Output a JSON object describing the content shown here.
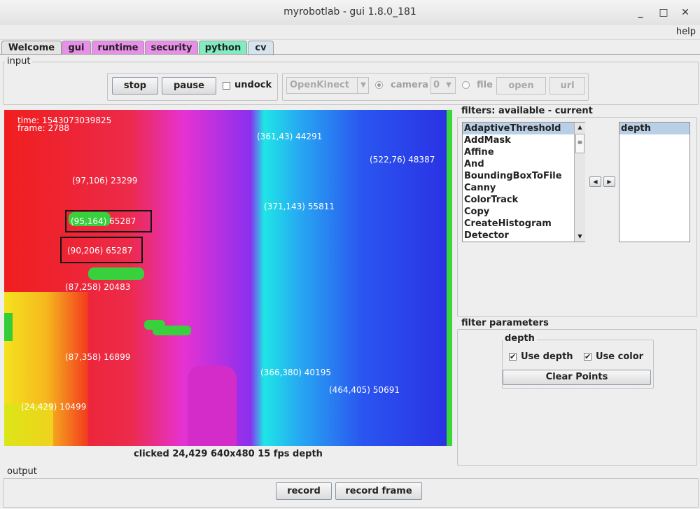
{
  "window": {
    "title": "myrobotlab - gui 1.8.0_181"
  },
  "menu": {
    "help": "help"
  },
  "tabs": [
    {
      "label": "Welcome",
      "color": "#dcdcdc"
    },
    {
      "label": "gui",
      "color": "#e890e8"
    },
    {
      "label": "runtime",
      "color": "#e890e8"
    },
    {
      "label": "security",
      "color": "#e890e8"
    },
    {
      "label": "python",
      "color": "#80ecc0"
    },
    {
      "label": "cv",
      "color": "#d6e4f0"
    }
  ],
  "input": {
    "title": "input",
    "stop": "stop",
    "pause": "pause",
    "undock": "undock",
    "grabber": "OpenKinect",
    "camera_label": "camera",
    "camera_index": "0",
    "file_label": "file",
    "open": "open",
    "url": "url"
  },
  "video": {
    "time": "time:  1543073039825",
    "frame": "frame: 2788",
    "points": [
      "(361,43) 44291",
      "(522,76) 48387",
      "(97,106) 23299",
      "(371,143) 55811",
      "(95,164) 65287",
      "(90,206) 65287",
      "(87,258) 20483",
      "(87,358) 16899",
      "(366,380) 40195",
      "(464,405) 50691",
      "(24,429) 10499"
    ]
  },
  "status": "clicked 24,429 640x480 15 fps depth",
  "filters": {
    "title": "filters: available - current",
    "available": [
      "AdaptiveThreshold",
      "AddMask",
      "Affine",
      "And",
      "BoundingBoxToFile",
      "Canny",
      "ColorTrack",
      "Copy",
      "CreateHistogram",
      "Detector"
    ],
    "current": [
      "depth"
    ]
  },
  "filter_params": {
    "title": "filter parameters",
    "group": "depth",
    "use_depth": "Use depth",
    "use_color": "Use color",
    "use_depth_checked": true,
    "use_color_checked": true,
    "clear_points": "Clear Points"
  },
  "output": {
    "title": "output",
    "record": "record",
    "record_frame": "record frame"
  }
}
